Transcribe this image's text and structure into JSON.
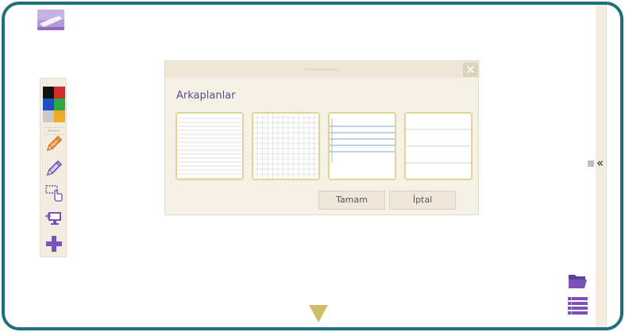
{
  "toolbar": {
    "palette_label": "Renkler",
    "colors": [
      "#111111",
      "#d42b2b",
      "#1f4fbf",
      "#2aa84a",
      "#c9c9c9",
      "#f0a928"
    ],
    "tools": [
      "pencil-icon",
      "highlighter-icon",
      "selection-icon",
      "screen-share-icon",
      "add-icon"
    ]
  },
  "dialog": {
    "title": "Arkaplanlar",
    "close_label": "✕",
    "backgrounds": [
      "lined-paper",
      "grid-paper",
      "music-staff-paper",
      "wide-lined-paper"
    ],
    "ok_label": "Tamam",
    "cancel_label": "İptal"
  },
  "right_panel": {
    "collapse_label": "«"
  },
  "accent_colors": {
    "frame": "#1f6f7f",
    "purple": "#7b52b8",
    "title_text": "#5a4a9a",
    "panel_bg": "#f3ede1",
    "thumb_border": "#e0d394",
    "arrow": "#cdbd6a"
  }
}
